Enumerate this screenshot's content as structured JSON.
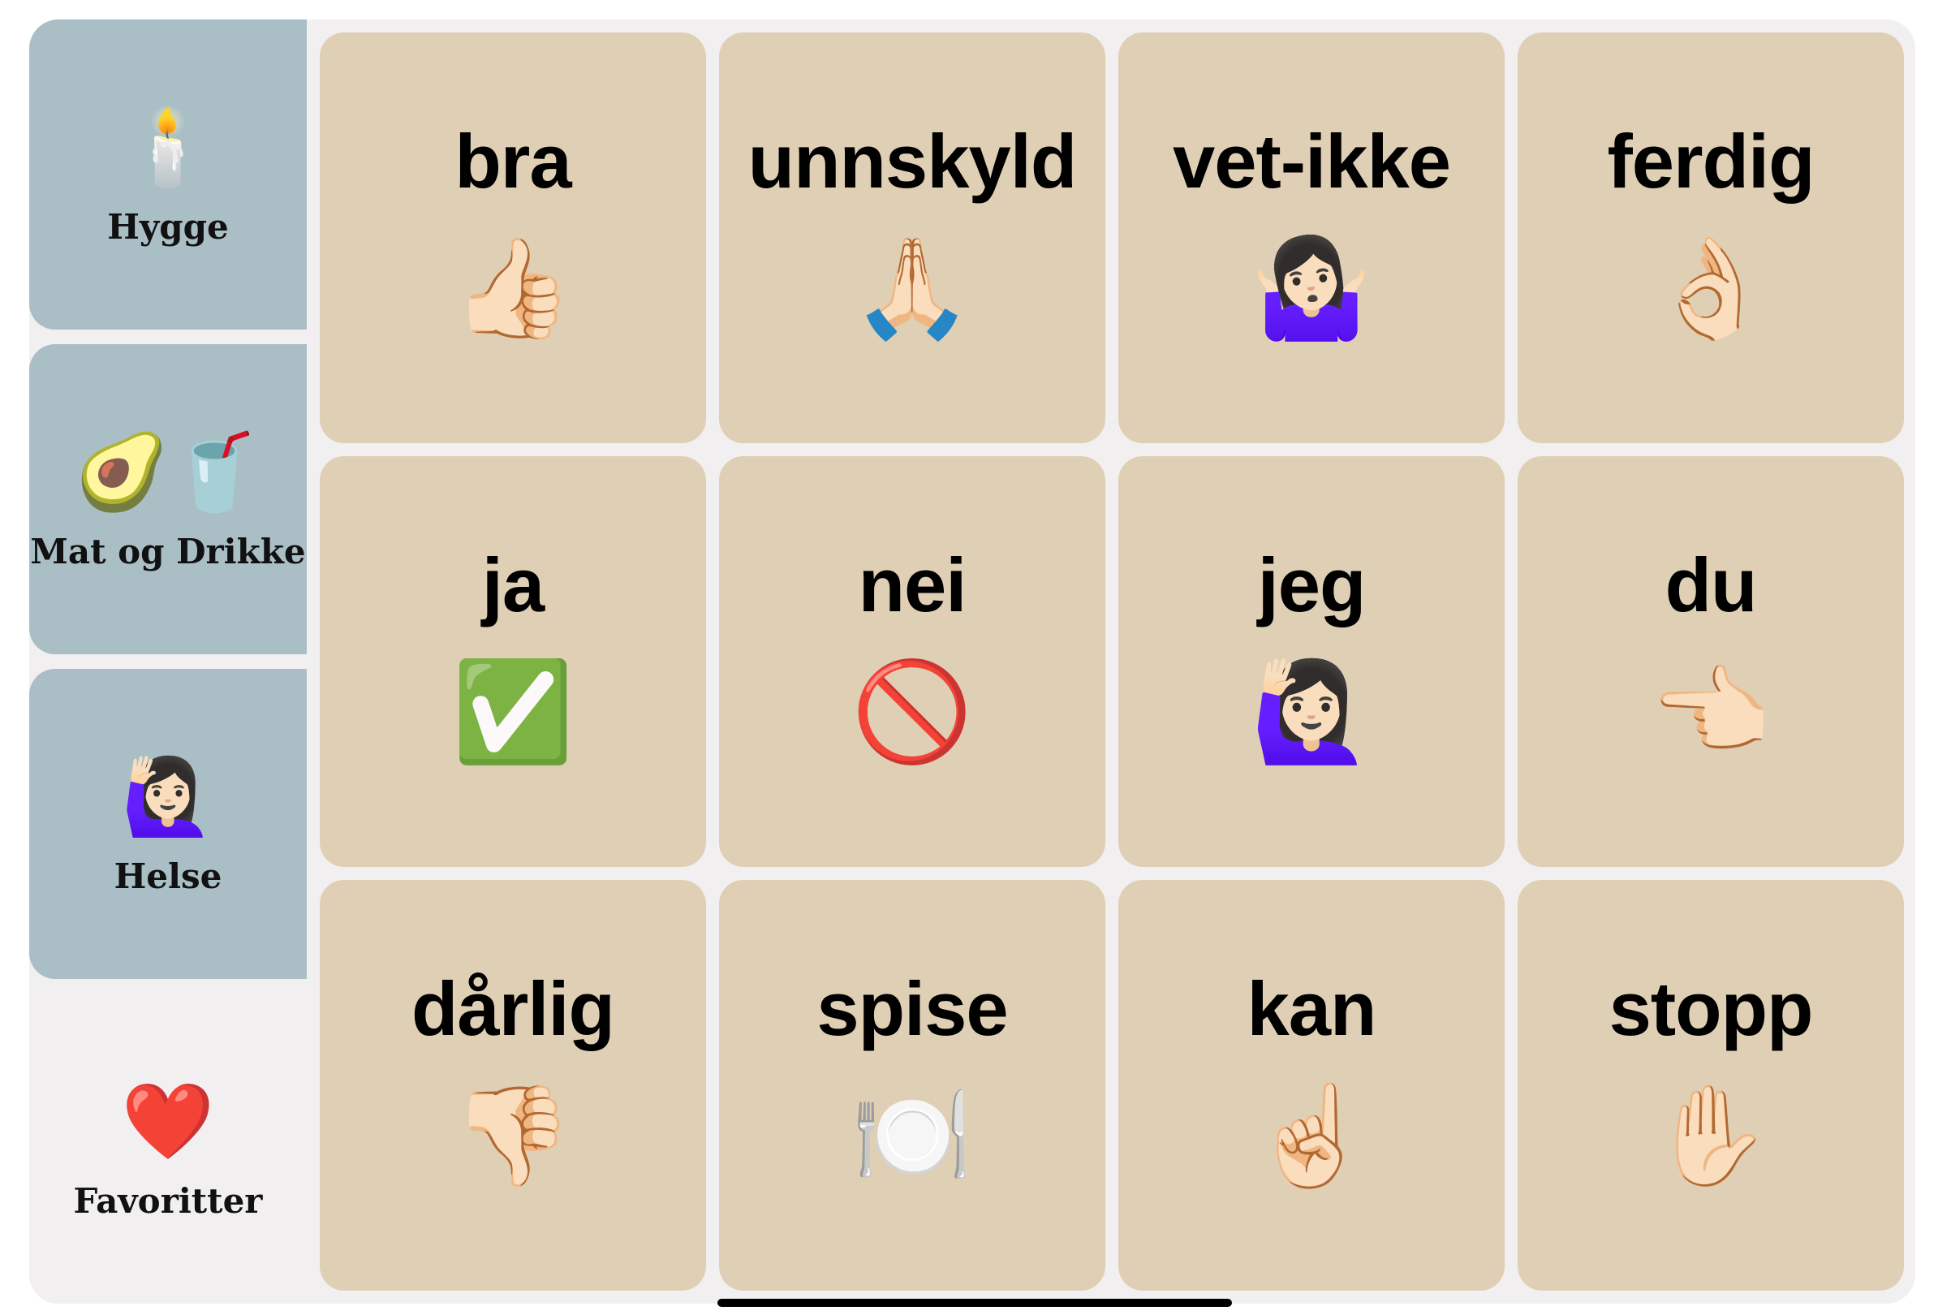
{
  "sidebar": {
    "categories": [
      {
        "label": "Hygge",
        "emoji": "🕯️",
        "icon": "candle-icon",
        "color": "#aabec5"
      },
      {
        "label": "Mat og Drikke",
        "emoji": "🥑🥤",
        "icon": "avocado-drink-icon",
        "color": "#aabec5"
      },
      {
        "label": "Helse",
        "emoji": "🙋🏻‍♀️",
        "icon": "person-raising-hand-icon",
        "color": "#aabec5"
      },
      {
        "label": "Favoritter",
        "emoji": "❤️",
        "icon": "heart-icon",
        "color": "#f2eff0",
        "selected": true
      }
    ]
  },
  "tiles": [
    {
      "word": "bra",
      "emoji": "👍🏻",
      "icon": "thumbs-up-icon"
    },
    {
      "word": "unnskyld",
      "emoji": "🙏🏻",
      "icon": "folded-hands-icon"
    },
    {
      "word": "vet-ikke",
      "emoji": "🤷🏻‍♀️",
      "icon": "shrug-icon"
    },
    {
      "word": "ferdig",
      "emoji": "👌🏻",
      "icon": "ok-hand-icon"
    },
    {
      "word": "ja",
      "emoji": "✅",
      "icon": "check-mark-icon"
    },
    {
      "word": "nei",
      "emoji": "🚫",
      "icon": "prohibited-icon"
    },
    {
      "word": "jeg",
      "emoji": "🙋🏻‍♀️",
      "icon": "person-raising-hand-icon"
    },
    {
      "word": "du",
      "emoji": "👈🏻",
      "icon": "pointing-left-icon"
    },
    {
      "word": "dårlig",
      "emoji": "👎🏻",
      "icon": "thumbs-down-icon"
    },
    {
      "word": "spise",
      "emoji": "🍽️",
      "icon": "fork-knife-plate-icon"
    },
    {
      "word": "kan",
      "emoji": "☝🏻",
      "icon": "index-pointing-up-icon"
    },
    {
      "word": "stopp",
      "emoji": "✋🏻",
      "icon": "raised-hand-icon"
    }
  ],
  "colors": {
    "tile_background": "#dfcfb5",
    "category_background": "#aabec5",
    "panel_background": "#f2eff0"
  }
}
